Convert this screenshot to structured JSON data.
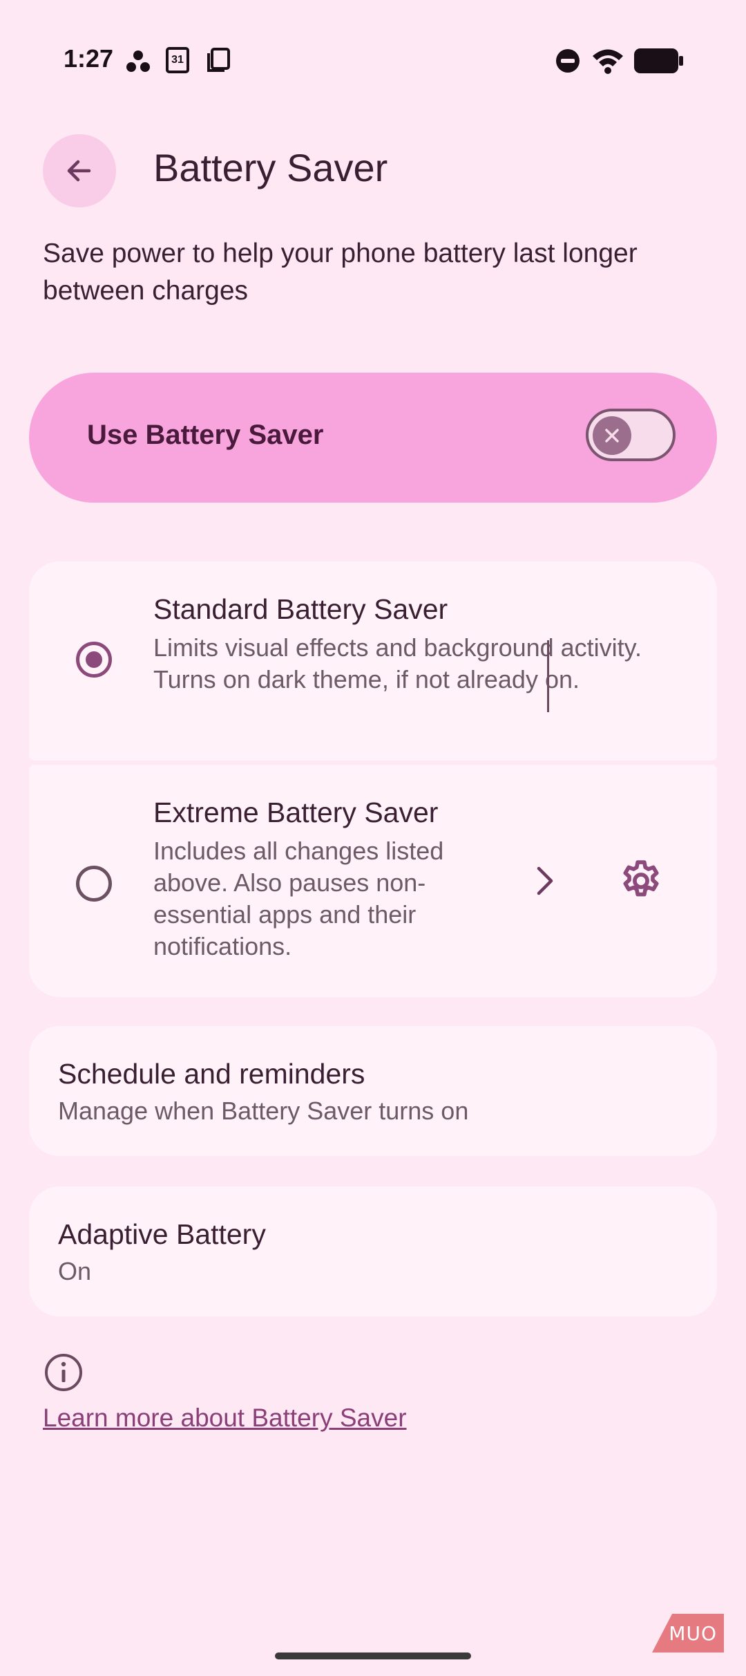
{
  "status_bar": {
    "time": "1:27",
    "left_icons": [
      "apps-dots-icon",
      "calendar-icon",
      "copy-icon"
    ],
    "calendar_day": "31",
    "right_icons": [
      "do-not-disturb-icon",
      "wifi-icon",
      "battery-icon"
    ]
  },
  "header": {
    "back_icon": "arrow-back-icon",
    "title": "Battery Saver"
  },
  "description": "Save power to help your phone battery last longer between charges",
  "main_toggle": {
    "label": "Use Battery Saver",
    "state": "off",
    "thumb_icon": "close-icon"
  },
  "modes": [
    {
      "title": "Standard Battery Saver",
      "description": "Limits visual effects and background activity. Turns on dark theme, if not already on.",
      "selected": true
    },
    {
      "title": "Extreme Battery Saver",
      "description": "Includes all changes listed above. Also pauses non-essential apps and their notifications.",
      "selected": false,
      "actions": [
        "chevron-right-icon",
        "gear-icon"
      ]
    }
  ],
  "schedule": {
    "title": "Schedule and reminders",
    "subtitle": "Manage when Battery Saver turns on"
  },
  "adaptive": {
    "title": "Adaptive Battery",
    "subtitle": "On"
  },
  "footer": {
    "info_icon": "info-icon",
    "link": "Learn more about Battery Saver"
  },
  "watermark": "MUO",
  "colors": {
    "background": "#fde8f4",
    "toggle_card": "#f9a5dd",
    "card": "#fff2f8",
    "accent": "#8c4a7c",
    "link": "#8b3f78"
  }
}
